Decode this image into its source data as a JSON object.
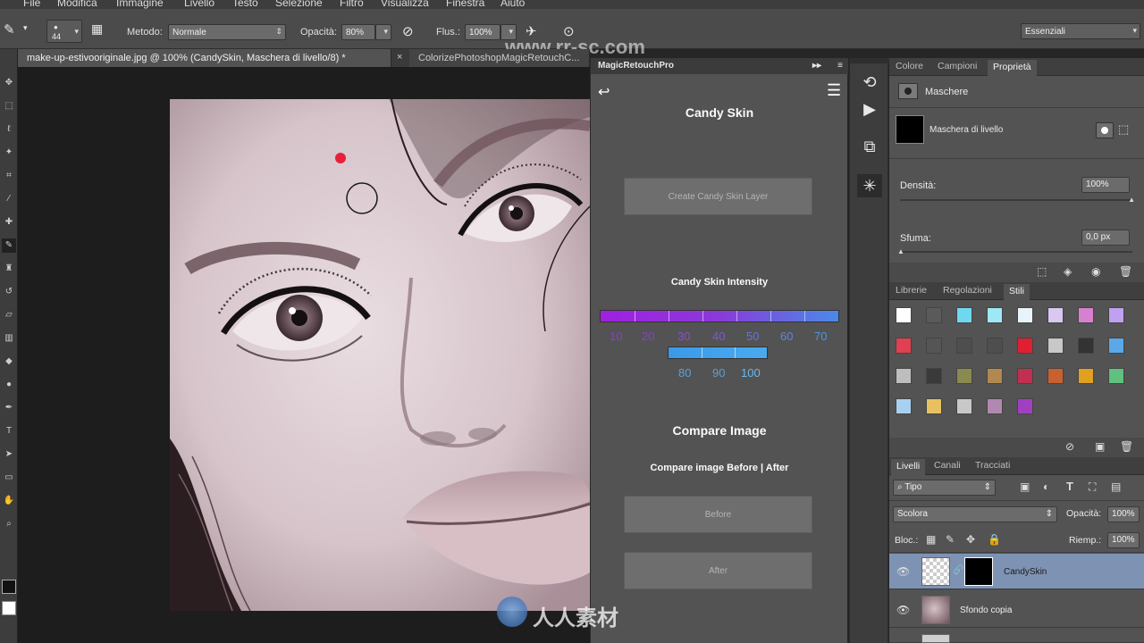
{
  "menu": [
    "File",
    "Modifica",
    "Immagine",
    "Livello",
    "Testo",
    "Selezione",
    "Filtro",
    "Visualizza",
    "Finestra",
    "Aiuto"
  ],
  "options": {
    "brush_size": "44",
    "metodo_label": "Metodo:",
    "metodo_value": "Normale",
    "opacita_label": "Opacità:",
    "opacita_value": "80%",
    "flusso_label": "Flus.:",
    "flusso_value": "100%",
    "workspace": "Essenziali"
  },
  "watermark": "www.rr-sc.com",
  "tabs": [
    {
      "label": "make-up-estivooriginale.jpg @ 100% (CandySkin, Maschera di livello/8) *"
    },
    {
      "label": "ColorizePhotoshopMagicRetouchC..."
    }
  ],
  "plugin": {
    "title": "MagicRetouchPro",
    "section1_title": "Candy Skin",
    "create_button": "Create Candy Skin Layer",
    "intensity_title": "Candy Skin Intensity",
    "row1": [
      "10",
      "20",
      "30",
      "40",
      "50",
      "60",
      "70"
    ],
    "row2": [
      "80",
      "90",
      "100"
    ],
    "compare_title": "Compare Image",
    "compare_sub": "Compare image Before | After",
    "before_button": "Before",
    "after_button": "After"
  },
  "right": {
    "tabs1": [
      "Colore",
      "Campioni",
      "Proprietà"
    ],
    "maschere": "Maschere",
    "maschera_livello": "Maschera di livello",
    "densita_label": "Densità:",
    "densita_value": "100%",
    "sfuma_label": "Sfuma:",
    "sfuma_value": "0,0 px",
    "tabs2": [
      "Librerie",
      "Regolazioni",
      "Stili"
    ],
    "tabs3": [
      "Livelli",
      "Canali",
      "Tracciati"
    ],
    "tipo": "Tipo",
    "blend": "Scolora",
    "opacita_label": "Opacità:",
    "opacita_value": "100%",
    "blocca_label": "Bloc.:",
    "riemp_label": "Riemp.:",
    "riemp_value": "100%",
    "layers": [
      {
        "name": "CandySkin"
      },
      {
        "name": "Sfondo copia"
      }
    ]
  },
  "footer_logo": "人人素材"
}
